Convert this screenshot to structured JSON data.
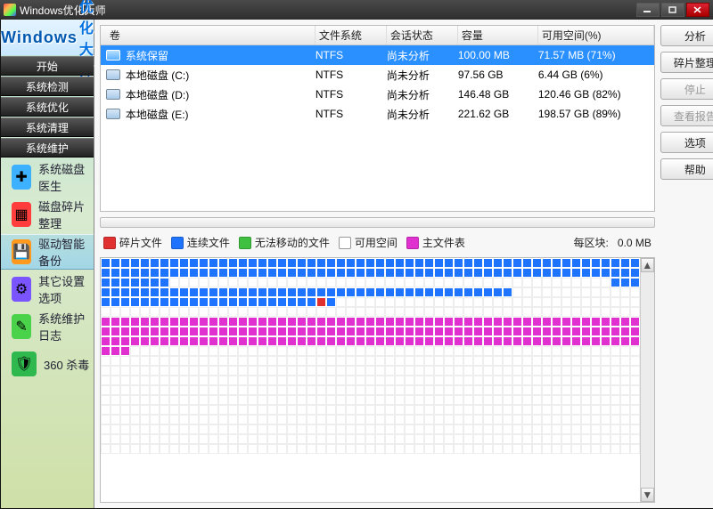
{
  "title": "Windows优化大师",
  "logo": {
    "line1": "Windows",
    "line2": "优化大师"
  },
  "nav": [
    "开始",
    "系统检测",
    "系统优化",
    "系统清理",
    "系统维护"
  ],
  "tools": [
    {
      "label": "系统磁盘医生",
      "icon": "plus-icon",
      "color": "#3db0ff"
    },
    {
      "label": "磁盘碎片整理",
      "icon": "cubes-icon",
      "color": "#ff3d3d"
    },
    {
      "label": "驱动智能备份",
      "icon": "floppy-icon",
      "color": "#ff9a1e",
      "selected": true
    },
    {
      "label": "其它设置选项",
      "icon": "gear-icon",
      "color": "#7a55ff"
    },
    {
      "label": "系统维护日志",
      "icon": "pencil-icon",
      "color": "#4ad24a"
    },
    {
      "label": "360 杀毒",
      "icon": "shield-icon",
      "color": "#2fb84d"
    }
  ],
  "columns": {
    "volume": "卷",
    "fs": "文件系统",
    "status": "会话状态",
    "capacity": "容量",
    "free": "可用空间(%)"
  },
  "volumes": [
    {
      "name": "系统保留",
      "fs": "NTFS",
      "status": "尚未分析",
      "capacity": "100.00 MB",
      "free": "71.57 MB (71%)",
      "selected": true
    },
    {
      "name": "本地磁盘 (C:)",
      "fs": "NTFS",
      "status": "尚未分析",
      "capacity": "97.56 GB",
      "free": "6.44 GB (6%)"
    },
    {
      "name": "本地磁盘 (D:)",
      "fs": "NTFS",
      "status": "尚未分析",
      "capacity": "146.48 GB",
      "free": "120.46 GB (82%)"
    },
    {
      "name": "本地磁盘 (E:)",
      "fs": "NTFS",
      "status": "尚未分析",
      "capacity": "221.62 GB",
      "free": "198.57 GB (89%)"
    }
  ],
  "actions": {
    "analyze": "分析",
    "defrag": "碎片整理",
    "stop": "停止",
    "report": "查看报告",
    "options": "选项",
    "help": "帮助"
  },
  "legend": {
    "frag": {
      "label": "碎片文件",
      "color": "#e03030"
    },
    "contig": {
      "label": "连续文件",
      "color": "#1e73ff"
    },
    "immov": {
      "label": "无法移动的文件",
      "color": "#40c040"
    },
    "free": {
      "label": "可用空间",
      "color": "#ffffff"
    },
    "mft": {
      "label": "主文件表",
      "color": "#e030d0"
    },
    "blocksize_label": "每区块:",
    "blocksize_value": "0.0 MB"
  },
  "map_cols": 55,
  "map_spec": [
    "BBBBBBBBBBBBBBBBBBBBBBBBBBBBBBBBBBBBBBBBBBBBBBBBBBBBBBB",
    "BBBBBBBBBBBBBBBBBBBBBBBBBBBBBBBBBBBBBBBBBBBBBBBBBBBBBBB",
    "BBBBBBBWWWWWWWWWWWWWWWWWWWWWWWWWWWWWWWWWWWWWWWWWWWWWBBB",
    "BBBBBBBBBBBBBBBBBBBBBBBBBBBBBBBBBBBBBBBBBBWWWWWWWWWWWWW",
    "BBBBBBBBBBBBBBBBBBBBBBRBWWWWWWWWWWWWWWWWWWWWWWWWWWWWWWW",
    "WWWWWWWWWWWWWWWWWWWWWWWWWWWWWWWWWWWWWWWWWWWWWWWWWWWWWWW",
    "MMMMMMMMMMMMMMMMMMMMMMMMMMMMMMMMMMMMMMMMMMMMMMMMMMMMMMM",
    "MMMMMMMMMMMMMMMMMMMMMMMMMMMMMMMMMMMMMMMMMMMMMMMMMMMMMMM",
    "MMMMMMMMMMMMMMMMMMMMMMMMMMMMMMMMMMMMMMMMMMMMMMMMMMMMMMM",
    "MMMWWWWWWWWWWWWWWWWWWWWWWWWWWWWWWWWWWWWWWWWWWWWWWWWWWWW",
    "WWWWWWWWWWWWWWWWWWWWWWWWWWWWWWWWWWWWWWWWWWWWWWWWWWWWWWW",
    "WWWWWWWWWWWWWWWWWWWWWWWWWWWWWWWWWWWWWWWWWWWWWWWWWWWWWWW",
    "WWWWWWWWWWWWWWWWWWWWWWWWWWWWWWWWWWWWWWWWWWWWWWWWWWWWWWW",
    "WWWWWWWWWWWWWWWWWWWWWWWWWWWWWWWWWWWWWWWWWWWWWWWWWWWWWWW",
    "WWWWWWWWWWWWWWWWWWWWWWWWWWWWWWWWWWWWWWWWWWWWWWWWWWWWWWW",
    "WWWWWWWWWWWWWWWWWWWWWWWWWWWWWWWWWWWWWWWWWWWWWWWWWWWWWWW",
    "WWWWWWWWWWWWWWWWWWWWWWWWWWWWWWWWWWWWWWWWWWWWWWWWWWWWWWW",
    "WWWWWWWWWWWWWWWWWWWWWWWWWWWWWWWWWWWWWWWWWWWWWWWWWWWWWWW",
    "WWWWWWWWWWWWWWWWWWWWWWWWWWWWWWWWWWWWWWWWWWWWWWWWWWWWWWW",
    "WWWWWWWWWWWWWWWWWWWWWWWWWWWWWWWWWWWWWWWWWWWWWWWWWWWWWWW"
  ]
}
